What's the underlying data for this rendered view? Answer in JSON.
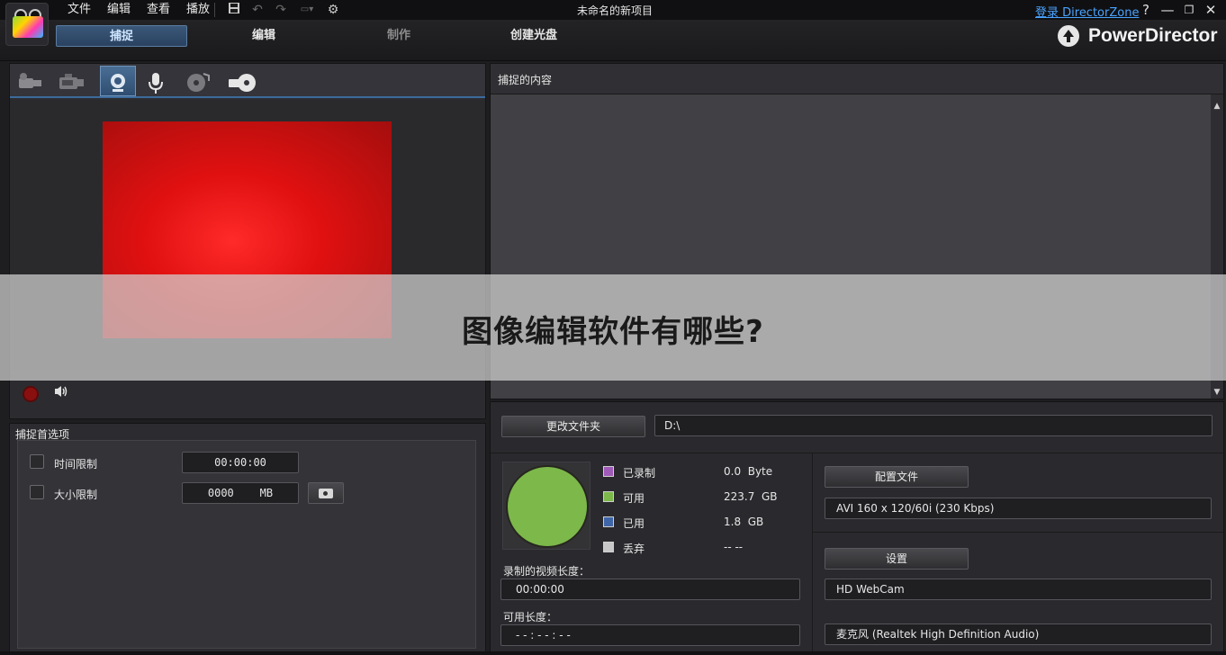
{
  "titlebar": {
    "menu": [
      "文件",
      "编辑",
      "查看",
      "播放"
    ],
    "window_title": "未命名的新项目",
    "login_link": "登录 DirectorZone",
    "help": "?",
    "minimize": "—",
    "restore": "❐",
    "close": "✕"
  },
  "modes": {
    "capture": "捕捉",
    "edit": "编辑",
    "produce": "制作",
    "create_disc": "创建光盘"
  },
  "brand": "PowerDirector",
  "content": {
    "title": "捕捉的内容"
  },
  "options": {
    "title": "捕捉首选项",
    "time_limit_label": "时间限制",
    "time_limit_value": "00:00:00",
    "size_limit_label": "大小限制",
    "size_limit_value": "0000    MB"
  },
  "storage": {
    "change_folder_label": "更改文件夹",
    "path": "D:\\",
    "legend": [
      {
        "label": "已录制",
        "value": "0.0  Byte",
        "color": "#a05ab8"
      },
      {
        "label": "可用",
        "value": "223.7  GB",
        "color": "#7cb84a"
      },
      {
        "label": "已用",
        "value": "1.8  GB",
        "color": "#3f66a8"
      },
      {
        "label": "丢弃",
        "value": "-- --",
        "color": "#c8c8c8"
      }
    ],
    "recorded_length_label": "录制的视频长度：",
    "recorded_length_value": "00:00:00",
    "available_length_label": "可用长度：",
    "available_length_value": "- - : - - : - -"
  },
  "config": {
    "profile_label": "配置文件",
    "profile_value": "AVI 160 x 120/60i (230 Kbps)",
    "settings_label": "设置",
    "device_value": "HD WebCam",
    "audio_value": "麦克风 (Realtek High Definition Audio)"
  },
  "overlay": {
    "text": "图像编辑软件有哪些?"
  }
}
